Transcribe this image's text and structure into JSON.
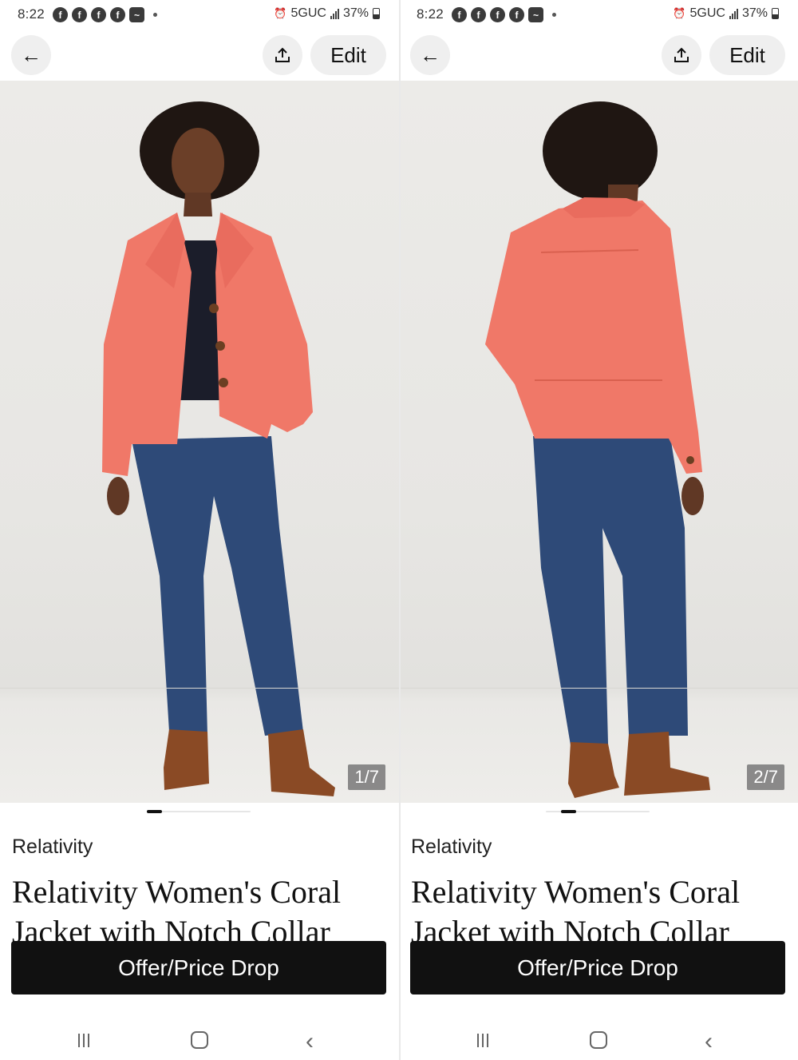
{
  "screens": [
    {
      "status": {
        "time": "8:22",
        "network": "5GUC",
        "battery": "37%"
      },
      "toolbar": {
        "edit_label": "Edit"
      },
      "photo": {
        "counter": "1/7",
        "view": "front",
        "page_index": 0,
        "page_count": 7
      },
      "brand": "Relativity",
      "title": "Relativity Women's Coral Jacket with Notch Collar",
      "offer_button": "Offer/Price Drop"
    },
    {
      "status": {
        "time": "8:22",
        "network": "5GUC",
        "battery": "37%"
      },
      "toolbar": {
        "edit_label": "Edit"
      },
      "photo": {
        "counter": "2/7",
        "view": "back",
        "page_index": 1,
        "page_count": 7
      },
      "brand": "Relativity",
      "title": "Relativity Women's Coral Jacket with Notch Collar",
      "offer_button": "Offer/Price Drop"
    }
  ],
  "colors": {
    "jacket": "#f07868",
    "jeans": "#2e4a78",
    "boots": "#8a4a25",
    "button_dark": "#111111"
  },
  "icons": {
    "back": "arrow-left-icon",
    "share": "share-upload-icon",
    "alarm": "alarm-icon",
    "signal": "signal-icon",
    "battery": "battery-icon"
  }
}
